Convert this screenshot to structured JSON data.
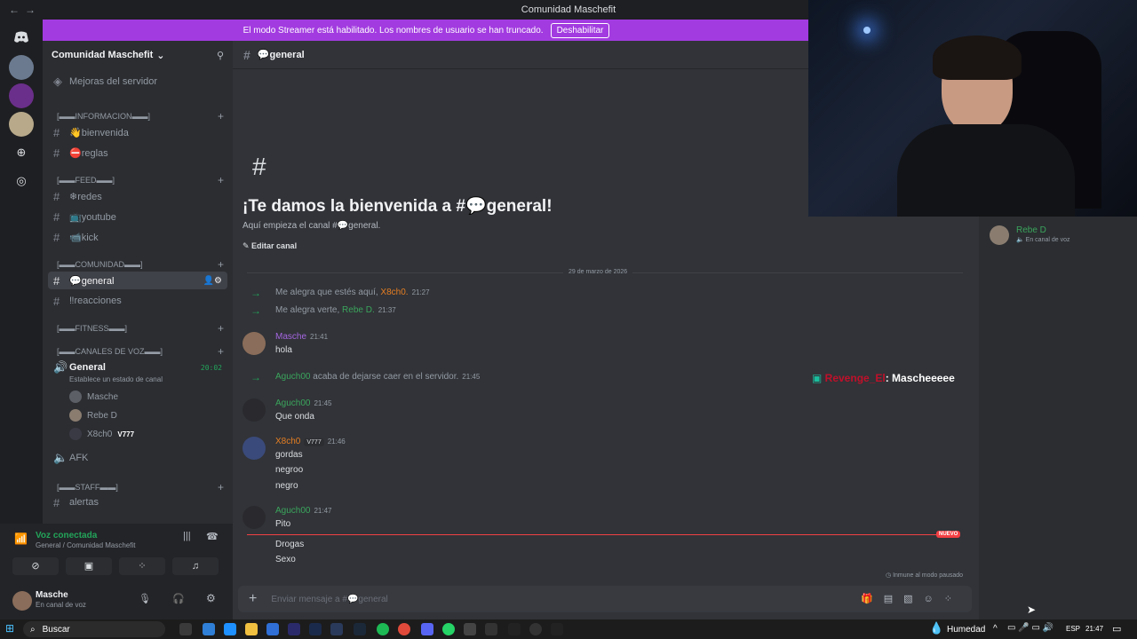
{
  "titlebar": {
    "title": "Comunidad Maschefit",
    "back": "←",
    "forward": "→"
  },
  "banner": {
    "text": "El modo Streamer está habilitado. Los nombres de usuario se han truncado.",
    "button": "Deshabilitar"
  },
  "server": {
    "name": "Comunidad Maschefit"
  },
  "sidebar": {
    "boost": "Mejoras del servidor",
    "categories": {
      "info": "[▬▬INFORMACION▬▬]",
      "feed": "[▬▬FEED▬▬]",
      "comunidad": "[▬▬COMUNIDAD▬▬]",
      "fitness": "[▬▬FITNESS▬▬]",
      "voz": "[▬▬CANALES DE VOZ▬▬]",
      "staff": "[▬▬STAFF▬▬]"
    },
    "channels": {
      "bienvenida": "👋bienvenida",
      "reglas": "⛔reglas",
      "redes": "❄redes",
      "youtube": "📺youtube",
      "kick": "📹kick",
      "general": "💬general",
      "reacciones": "‼reacciones",
      "voice_general": "General",
      "voice_status": "Establece un estado de canal",
      "voice_timer": "20:02",
      "afk": "AFK",
      "alertas": "alertas"
    },
    "voice_users": [
      "Masche",
      "Rebe D",
      "X8ch0"
    ],
    "voice_user_tag": "V777"
  },
  "voice_panel": {
    "status": "Voz conectada",
    "location": "General / Comunidad Maschefit"
  },
  "user_panel": {
    "name": "Masche",
    "status": "En canal de voz"
  },
  "channel": {
    "header": "💬general",
    "welcome_title": "¡Te damos la bienvenida a #💬general!",
    "welcome_sub": "Aquí empieza el canal #💬general.",
    "edit_button": "Editar canal",
    "date_divider": "29 de marzo de 2026",
    "new_badge": "NUEVO",
    "immune_note": "Inmune al modo pausado",
    "composer_placeholder": "Enviar mensaje a #💬general"
  },
  "messages": {
    "sys1": {
      "text": "Me alegra que estés aquí, ",
      "user": "X8ch0.",
      "time": "21:27"
    },
    "sys2": {
      "text": "Me alegra verte, ",
      "user": "Rebe D.",
      "time": "21:37"
    },
    "m1": {
      "user": "Masche",
      "time": "21:41",
      "lines": [
        "hola"
      ]
    },
    "sys3": {
      "user": "Aguch00",
      "text": " acaba de dejarse caer en el servidor.",
      "time": "21:45"
    },
    "m2": {
      "user": "Aguch00",
      "time": "21:45",
      "lines": [
        "Que onda"
      ]
    },
    "m3": {
      "user": "X8ch0",
      "tag": "V777",
      "time": "21:46",
      "lines": [
        "gordas",
        "negroo",
        "negro"
      ]
    },
    "m4": {
      "user": "Aguch00",
      "time": "21:47",
      "lines": [
        "Pito",
        "Drogas",
        "Sexo"
      ]
    }
  },
  "overlay": {
    "name": "Revenge_El",
    "text": ": Mascheeeee"
  },
  "members": [
    {
      "name": "Rebe D",
      "status": "En canal de voz"
    }
  ],
  "taskbar": {
    "search": "Buscar",
    "weather": "Humedad",
    "lang": "ESP",
    "time": "21:47"
  },
  "colors": {
    "accent_green": "#23a55a",
    "banner_purple": "#a23be0",
    "masche": "#a566e0",
    "aguch": "#3ba55c",
    "x8ch0": "#e67e22",
    "rebe": "#3ba55c",
    "new_red": "#f23f43"
  }
}
